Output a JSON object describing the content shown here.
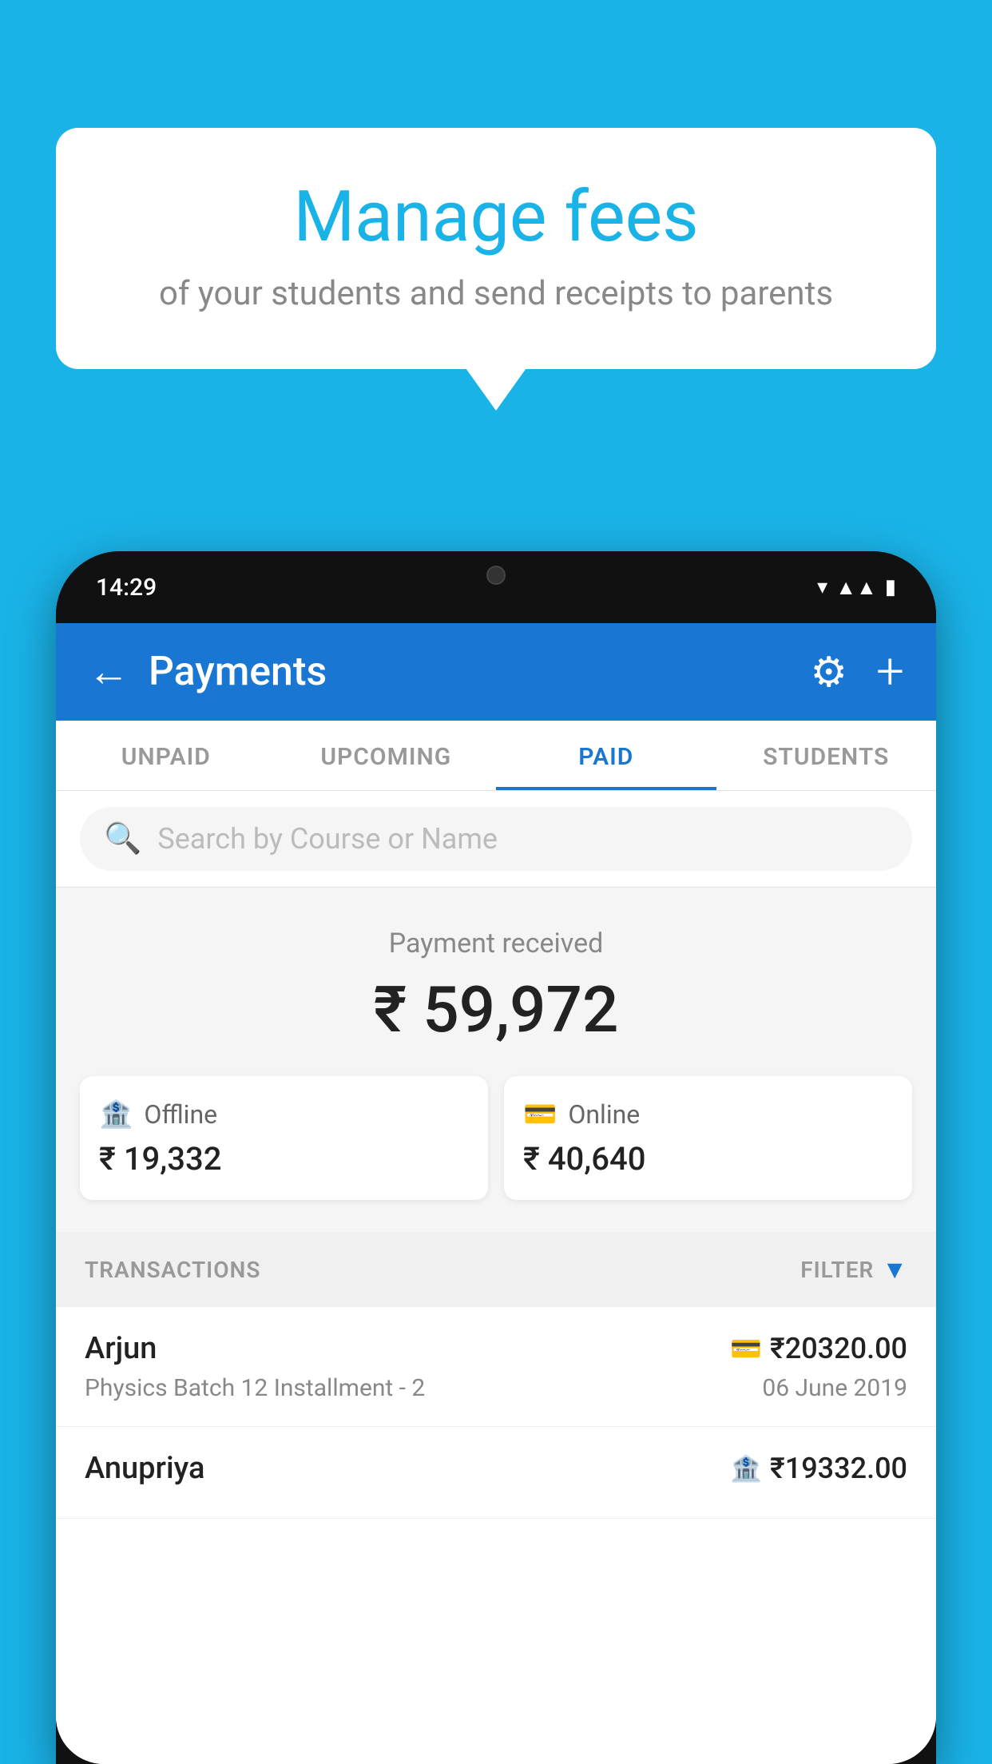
{
  "background_color": "#1ab3e8",
  "bubble": {
    "title": "Manage fees",
    "subtitle": "of your students and send receipts to parents"
  },
  "phone": {
    "status_bar": {
      "time": "14:29"
    }
  },
  "header": {
    "title": "Payments",
    "back_label": "←",
    "plus_label": "+"
  },
  "tabs": [
    {
      "label": "UNPAID",
      "active": false
    },
    {
      "label": "UPCOMING",
      "active": false
    },
    {
      "label": "PAID",
      "active": true
    },
    {
      "label": "STUDENTS",
      "active": false
    }
  ],
  "search": {
    "placeholder": "Search by Course or Name"
  },
  "payment_summary": {
    "label": "Payment received",
    "total": "₹ 59,972",
    "offline": {
      "label": "Offline",
      "amount": "₹ 19,332"
    },
    "online": {
      "label": "Online",
      "amount": "₹ 40,640"
    }
  },
  "transactions": {
    "section_label": "TRANSACTIONS",
    "filter_label": "FILTER",
    "items": [
      {
        "name": "Arjun",
        "amount": "₹20320.00",
        "description": "Physics Batch 12 Installment - 2",
        "date": "06 June 2019",
        "payment_type": "online"
      },
      {
        "name": "Anupriya",
        "amount": "₹19332.00",
        "description": "",
        "date": "",
        "payment_type": "offline"
      }
    ]
  }
}
